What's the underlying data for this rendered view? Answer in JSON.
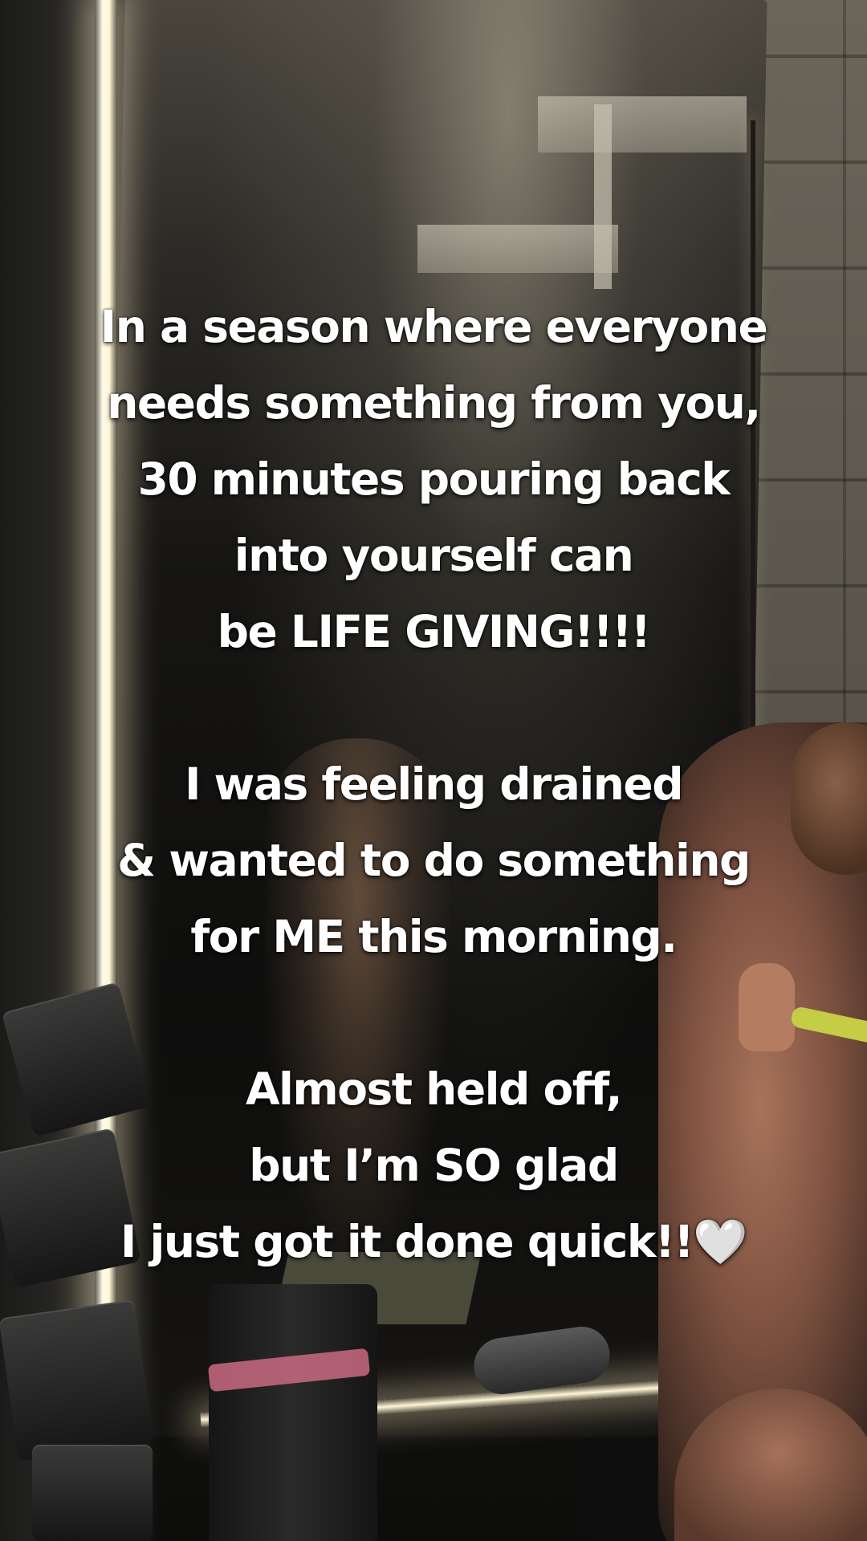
{
  "caption": {
    "paragraph1": [
      "In a season where everyone",
      "needs something from you,",
      "30 minutes pouring back",
      "into yourself can",
      "be LIFE GIVING!!!!"
    ],
    "paragraph2": [
      "I was feeling drained",
      "& wanted to do something",
      "for ME this morning."
    ],
    "paragraph3": [
      "Almost held off,",
      "but I’m SO glad",
      "I just got it done quick!!🤍"
    ]
  },
  "colors": {
    "caption_text": "#ffffff",
    "mirror_light": "#fff6d6",
    "sports_top": "#c5cc45",
    "resistance_band": "#c96b80"
  }
}
